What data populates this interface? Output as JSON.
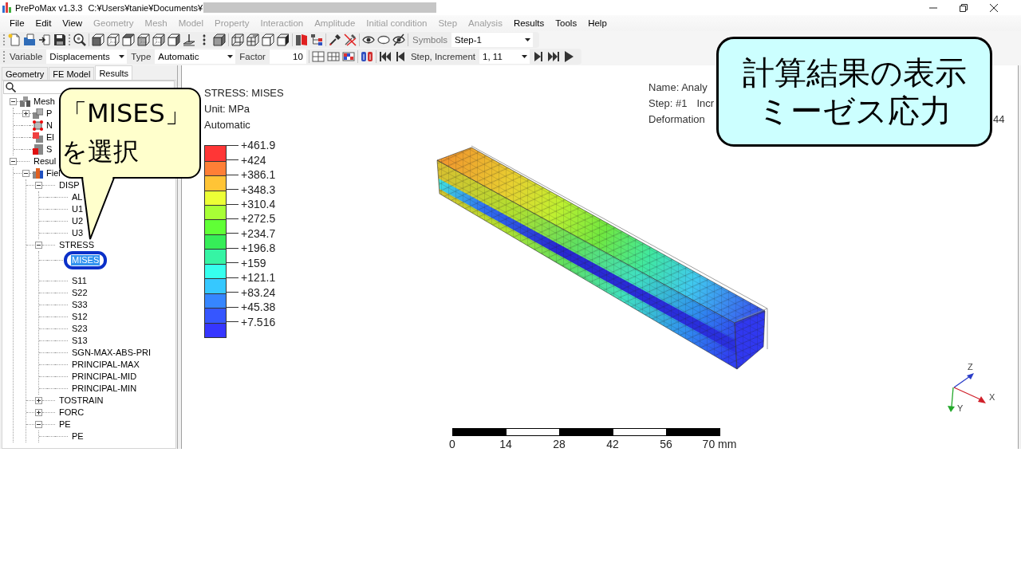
{
  "title_bar": {
    "app": "PrePoMax v1.3.3",
    "path": "C:¥Users¥tanie¥Documents¥",
    "path_hidden": true
  },
  "menu": [
    {
      "label": "File",
      "disabled": false
    },
    {
      "label": "Edit",
      "disabled": false
    },
    {
      "label": "View",
      "disabled": false
    },
    {
      "label": "Geometry",
      "disabled": true
    },
    {
      "label": "Mesh",
      "disabled": true
    },
    {
      "label": "Model",
      "disabled": true
    },
    {
      "label": "Property",
      "disabled": true
    },
    {
      "label": "Interaction",
      "disabled": true
    },
    {
      "label": "Amplitude",
      "disabled": true
    },
    {
      "label": "Initial condition",
      "disabled": true
    },
    {
      "label": "Step",
      "disabled": true
    },
    {
      "label": "Analysis",
      "disabled": true
    },
    {
      "label": "Results",
      "disabled": false
    },
    {
      "label": "Tools",
      "disabled": false
    },
    {
      "label": "Help",
      "disabled": false
    }
  ],
  "symbols": {
    "label": "Symbols",
    "disabled": true,
    "value": "Step-1"
  },
  "results_toolbar": {
    "variable_label": "Variable",
    "variable": "Displacements",
    "type_label": "Type",
    "type": "Automatic",
    "factor_label": "Factor",
    "factor": "10",
    "step_label": "Step, Increment",
    "step_increment": "1, 11"
  },
  "panel_tabs": [
    {
      "label": "Geometry",
      "selected": false
    },
    {
      "label": "FE Model",
      "selected": false
    },
    {
      "label": "Results",
      "selected": true
    }
  ],
  "tree": [
    {
      "label": "Mesh",
      "kind": "mesh",
      "expanded": true,
      "selected": false,
      "circled": false,
      "children": [
        {
          "label": "P",
          "kind": "parts",
          "expanded": false,
          "selected": false,
          "circled": false
        },
        {
          "label": "N",
          "kind": "node_set",
          "selected": false,
          "circled": false
        },
        {
          "label": "El",
          "kind": "element_set",
          "selected": false,
          "circled": false
        },
        {
          "label": "S",
          "kind": "surface",
          "selected": false,
          "circled": false
        }
      ]
    },
    {
      "label": "Resul",
      "expanded": true,
      "selected": false,
      "circled": false,
      "children": [
        {
          "label": "Fiel",
          "kind": "field_output",
          "expanded": true,
          "selected": false,
          "circled": false,
          "children": [
            {
              "label": "DISP",
              "expanded": true,
              "selected": false,
              "circled": false,
              "children": [
                {
                  "label": "AL",
                  "selected": false,
                  "circled": false
                },
                {
                  "label": "U1",
                  "selected": false,
                  "circled": false
                },
                {
                  "label": "U2",
                  "selected": false,
                  "circled": false
                },
                {
                  "label": "U3",
                  "selected": false,
                  "circled": false
                }
              ]
            },
            {
              "label": "STRESS",
              "expanded": true,
              "selected": false,
              "circled": false,
              "children": [
                {
                  "label": "MISES",
                  "selected": true,
                  "circled": true
                },
                {
                  "label": "S11",
                  "selected": false,
                  "circled": false
                },
                {
                  "label": "S22",
                  "selected": false,
                  "circled": false
                },
                {
                  "label": "S33",
                  "selected": false,
                  "circled": false
                },
                {
                  "label": "S12",
                  "selected": false,
                  "circled": false
                },
                {
                  "label": "S23",
                  "selected": false,
                  "circled": false
                },
                {
                  "label": "S13",
                  "selected": false,
                  "circled": false
                },
                {
                  "label": "SGN-MAX-ABS-PRI",
                  "selected": false,
                  "circled": false
                },
                {
                  "label": "PRINCIPAL-MAX",
                  "selected": false,
                  "circled": false
                },
                {
                  "label": "PRINCIPAL-MID",
                  "selected": false,
                  "circled": false
                },
                {
                  "label": "PRINCIPAL-MIN",
                  "selected": false,
                  "circled": false
                }
              ]
            },
            {
              "label": "TOSTRAIN",
              "expanded": false,
              "selected": false,
              "circled": false
            },
            {
              "label": "FORC",
              "expanded": false,
              "selected": false,
              "circled": false
            },
            {
              "label": "PE",
              "expanded": true,
              "selected": false,
              "circled": false,
              "children": [
                {
                  "label": "PE",
                  "selected": false,
                  "circled": false
                }
              ]
            }
          ]
        }
      ]
    }
  ],
  "legend": {
    "title": "STRESS: MISES",
    "unit": "Unit: MPa",
    "mode": "Automatic",
    "bands": [
      {
        "color": "#ff3636"
      },
      {
        "color": "#ff7f36"
      },
      {
        "color": "#ffc436"
      },
      {
        "color": "#ecff36"
      },
      {
        "color": "#a8ff36"
      },
      {
        "color": "#60ff36"
      },
      {
        "color": "#36ee58"
      },
      {
        "color": "#36f4a4"
      },
      {
        "color": "#36ffee"
      },
      {
        "color": "#36c8ff"
      },
      {
        "color": "#3686ff"
      },
      {
        "color": "#3656ff"
      },
      {
        "color": "#3636ff"
      }
    ],
    "labels": [
      "+461.9",
      "+424",
      "+386.1",
      "+348.3",
      "+310.4",
      "+272.5",
      "+234.7",
      "+196.8",
      "+159",
      "+121.1",
      "+83.24",
      "+45.38",
      "+7.516"
    ]
  },
  "info": {
    "name": "Name: Analy",
    "step": "Step: #1",
    "increment": "Incr",
    "deformation": "Deformation",
    "deformation_tail": "44"
  },
  "scale_bar": {
    "labels": [
      "0",
      "14",
      "28",
      "42",
      "56",
      "70 mm"
    ]
  },
  "axes": [
    {
      "label": "Z",
      "color": "#2a3cc8"
    },
    {
      "label": "X",
      "color": "#d0202a"
    },
    {
      "label": "Y",
      "color": "#22a82a"
    }
  ],
  "callouts": [
    {
      "kind": "speech",
      "lines": [
        "「MISES」",
        "を選択"
      ]
    },
    {
      "kind": "box",
      "lines": [
        "計算結果の表示",
        "ミーゼス応力"
      ]
    }
  ]
}
